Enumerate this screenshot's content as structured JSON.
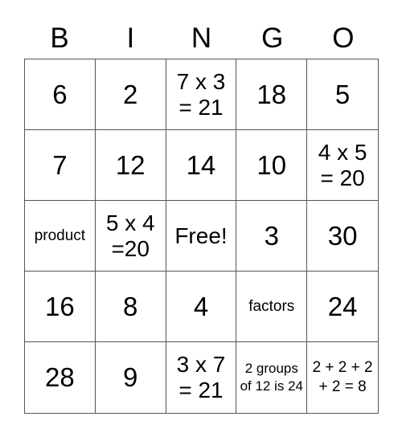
{
  "header": [
    "B",
    "I",
    "N",
    "G",
    "O"
  ],
  "cells": [
    "6",
    "2",
    "7 x 3 = 21",
    "18",
    "5",
    "7",
    "12",
    "14",
    "10",
    "4 x 5 = 20",
    "product",
    "5 x 4 =20",
    "Free!",
    "3",
    "30",
    "16",
    "8",
    "4",
    "factors",
    "24",
    "28",
    "9",
    "3 x 7 = 21",
    "2 groups of 12 is 24",
    "2 + 2 + 2 + 2 = 8"
  ]
}
